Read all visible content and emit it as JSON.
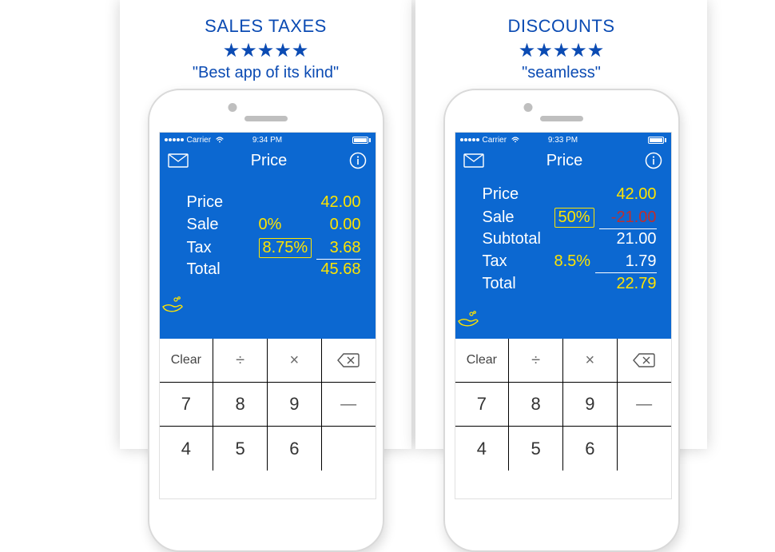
{
  "panels": {
    "left": {
      "headline": "SALES TAXES",
      "stars": "★★★★★",
      "quote": "\"Best app of its kind\"",
      "statusbar": {
        "carrier": "Carrier",
        "time": "9:34 PM"
      },
      "navbar": {
        "title": "Price"
      },
      "rows": {
        "price": {
          "label": "Price",
          "value": "42.00"
        },
        "sale": {
          "label": "Sale",
          "pct": "0%",
          "value": "0.00"
        },
        "tax": {
          "label": "Tax",
          "pct": "8.75%",
          "value": "3.68"
        },
        "total": {
          "label": "Total",
          "value": "45.68"
        }
      }
    },
    "right": {
      "headline": "DISCOUNTS",
      "stars": "★★★★★",
      "quote": "\"seamless\"",
      "statusbar": {
        "carrier": "Carrier",
        "time": "9:33 PM"
      },
      "navbar": {
        "title": "Price"
      },
      "rows": {
        "price": {
          "label": "Price",
          "value": "42.00"
        },
        "sale": {
          "label": "Sale",
          "pct": "50%",
          "value": "-21.00"
        },
        "subtotal": {
          "label": "Subtotal",
          "value": "21.00"
        },
        "tax": {
          "label": "Tax",
          "pct": "8.5%",
          "value": "1.79"
        },
        "total": {
          "label": "Total",
          "value": "22.79"
        }
      }
    }
  },
  "keypad": {
    "clear": "Clear",
    "divide": "÷",
    "multiply": "×",
    "backspace": "⌫",
    "minus": "—",
    "k7": "7",
    "k8": "8",
    "k9": "9",
    "k4": "4",
    "k5": "5",
    "k6": "6"
  }
}
